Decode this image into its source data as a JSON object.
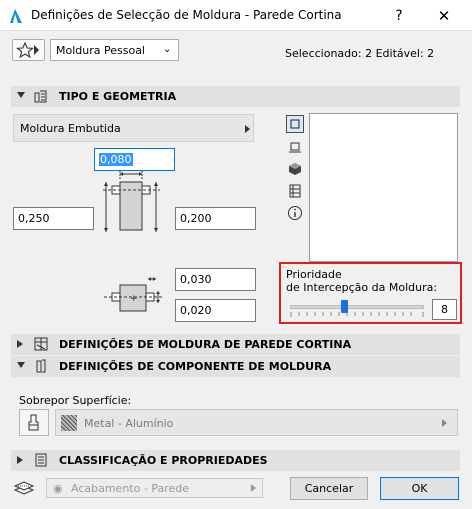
{
  "window": {
    "title": "Definições de Selecção de Moldura - Parede Cortina",
    "help_label": "?",
    "close_label": "✕"
  },
  "toolbar": {
    "favorites_icon": "star-icon",
    "preset_value": "Moldura Pessoal",
    "selection_info": "Seleccionado: 2 Editável: 2"
  },
  "sections": {
    "type_geometry": "TIPO E GEOMETRIA",
    "curtain_frame": "DEFINIÇÕES DE MOLDURA DE PAREDE CORTINA",
    "frame_component": "DEFINIÇÕES DE COMPONENTE DE MOLDURA",
    "classification": "CLASSIFICAÇÃO E PROPRIEDADES"
  },
  "geometry": {
    "frame_type": "Moldura Embutida",
    "width": "0,080",
    "depth_left": "0,250",
    "depth_right": "0,200",
    "offset_a": "0,030",
    "offset_b": "0,020"
  },
  "priority": {
    "label_line1": "Prioridade",
    "label_line2": "de Intercepção da Moldura:",
    "value": "8",
    "slider_fraction": 0.4
  },
  "surface": {
    "label": "Sobrepor Superfície:",
    "value": "Metal - Alumínio"
  },
  "footer": {
    "layer_value": "Acabamento - Parede",
    "cancel_label": "Cancelar",
    "ok_label": "OK"
  },
  "colors": {
    "highlight_border": "#e02020",
    "accent": "#0078d7"
  }
}
